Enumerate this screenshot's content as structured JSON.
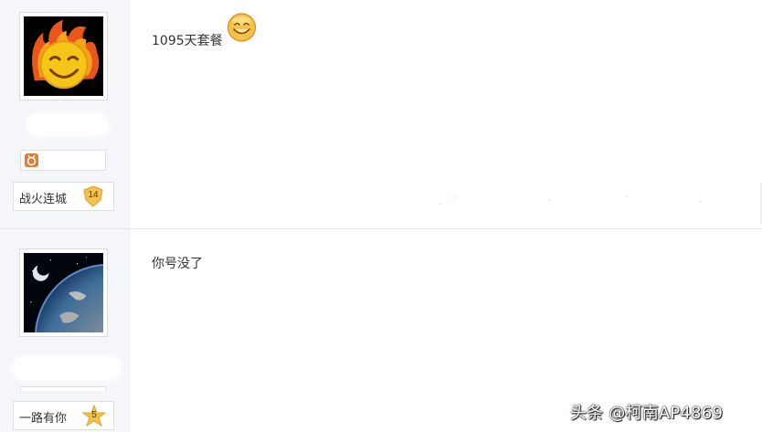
{
  "posts": [
    {
      "content": "1095天套餐",
      "emoticon_icon": "smiley-emoticon-icon",
      "author": {
        "avatar": "flaming-smiley-avatar",
        "badge_icon": "member-badge-icon",
        "forum_name": "战火连城",
        "level": "14"
      }
    },
    {
      "content": "你号没了",
      "author": {
        "avatar": "earth-orbit-avatar",
        "forum_name": "一路有你",
        "level": "5"
      }
    }
  ],
  "watermark": "头条 @柯南AP4869",
  "colors": {
    "sidebar_bg": "#f5f6fa",
    "level_badge": "#f2c14e",
    "badge_icon": "#e07b39"
  }
}
